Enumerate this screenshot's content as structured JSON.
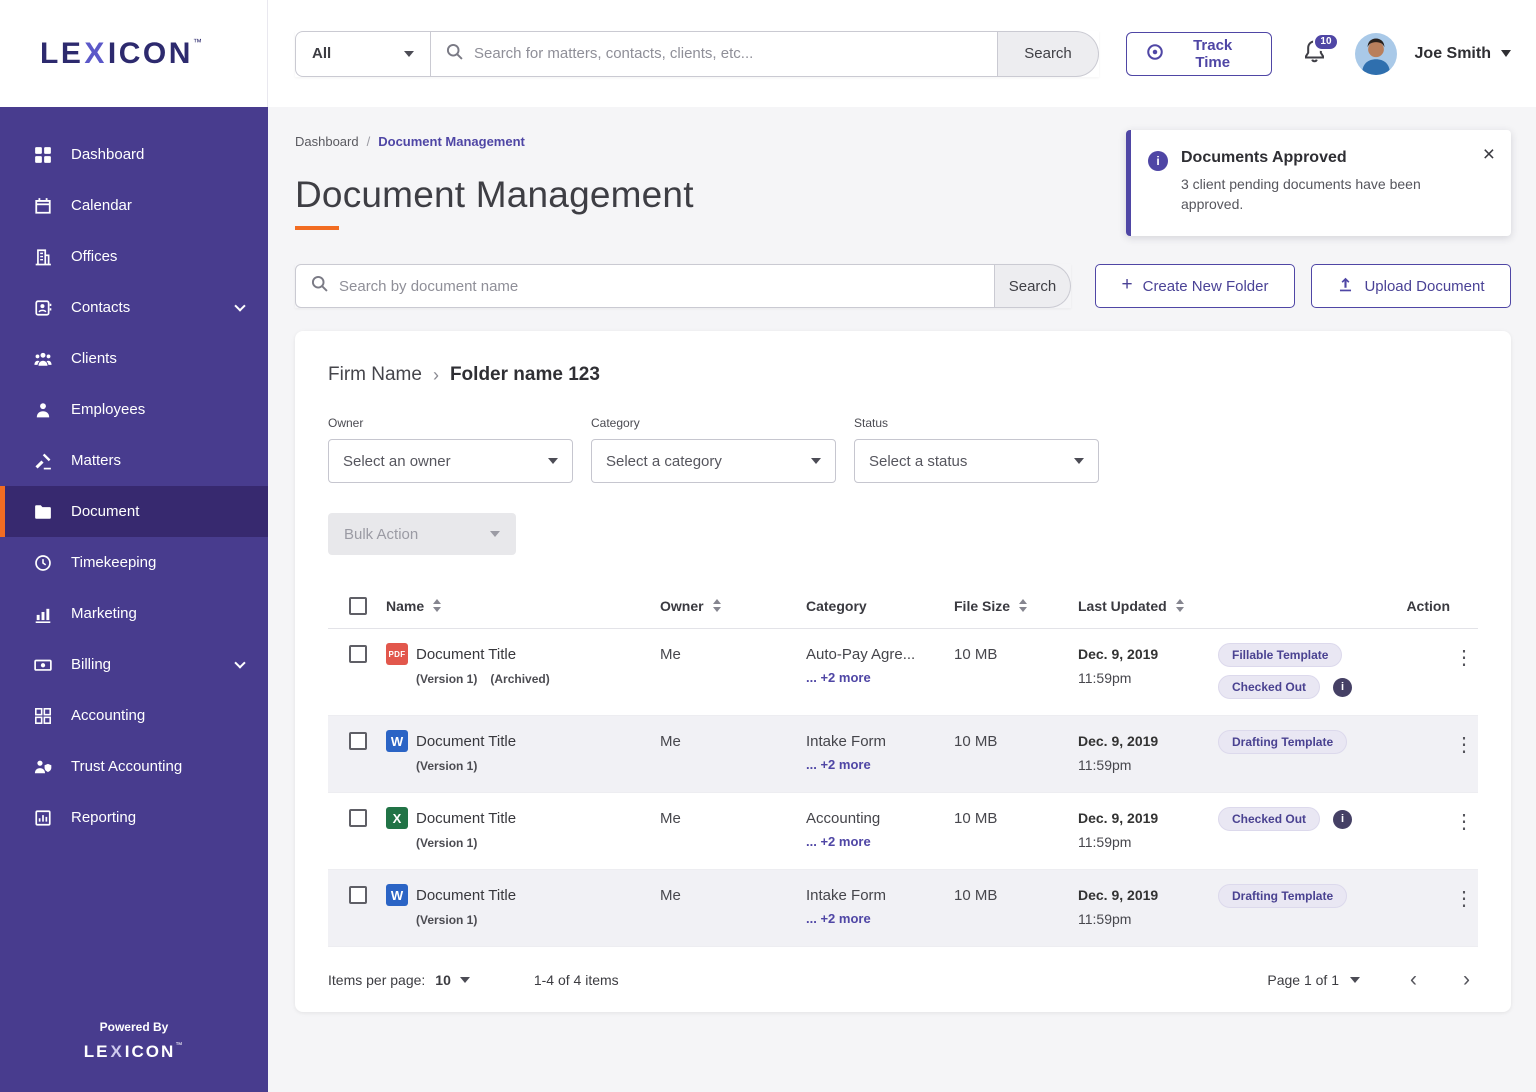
{
  "colors": {
    "accent_purple": "#4F46A5",
    "sidebar_purple": "#483C8E",
    "active_orange": "#F26C22"
  },
  "brand": {
    "logo_pre": "LE",
    "logo_x": "X",
    "logo_post": "ICON",
    "trademark": "™",
    "powered_by": "Powered By"
  },
  "topbar": {
    "scope_value": "All",
    "search_placeholder": "Search for matters, contacts, clients, etc...",
    "search_button": "Search",
    "track_time_button": "Track Time",
    "notification_count": "10",
    "user_name": "Joe Smith"
  },
  "sidebar": {
    "items": [
      {
        "label": "Dashboard"
      },
      {
        "label": "Calendar"
      },
      {
        "label": "Offices"
      },
      {
        "label": "Contacts"
      },
      {
        "label": "Clients"
      },
      {
        "label": "Employees"
      },
      {
        "label": "Matters"
      },
      {
        "label": "Document"
      },
      {
        "label": "Timekeeping"
      },
      {
        "label": "Marketing"
      },
      {
        "label": "Billing"
      },
      {
        "label": "Accounting"
      },
      {
        "label": "Trust Accounting"
      },
      {
        "label": "Reporting"
      }
    ]
  },
  "page": {
    "breadcrumb_home": "Dashboard",
    "breadcrumb_sep": "/",
    "breadcrumb_current": "Document Management",
    "title": "Document Management",
    "toast": {
      "title": "Documents Approved",
      "body": "3 client pending documents have been approved."
    },
    "doc_search_placeholder": "Search by document name",
    "doc_search_button": "Search",
    "create_folder_button": "Create New Folder",
    "upload_button": "Upload Document"
  },
  "folder": {
    "firm_name": "Firm Name",
    "separator": "›",
    "folder_name": "Folder name 123"
  },
  "filters": {
    "owner_label": "Owner",
    "owner_value": "Select an owner",
    "category_label": "Category",
    "category_value": "Select a category",
    "status_label": "Status",
    "status_value": "Select a status",
    "bulk_action_button": "Bulk Action"
  },
  "table": {
    "headers": {
      "name": "Name",
      "owner": "Owner",
      "category": "Category",
      "file_size": "File Size",
      "last_updated": "Last Updated",
      "action": "Action"
    },
    "rows": [
      {
        "file_type": "pdf",
        "file_label": "PDF",
        "name": "Document Title",
        "version": "(Version 1)",
        "archived": "(Archived)",
        "owner": "Me",
        "category": "Auto-Pay Agre...",
        "category_more": "... +2 more",
        "file_size": "10 MB",
        "date": "Dec. 9, 2019",
        "time": "11:59pm",
        "badges": [
          "Fillable Template",
          "Checked Out"
        ]
      },
      {
        "file_type": "word",
        "file_label": "W",
        "name": "Document Title",
        "version": "(Version 1)",
        "owner": "Me",
        "category": "Intake Form",
        "category_more": "... +2 more",
        "file_size": "10 MB",
        "date": "Dec. 9, 2019",
        "time": "11:59pm",
        "badges": [
          "Drafting Template"
        ]
      },
      {
        "file_type": "excel",
        "file_label": "X",
        "name": "Document Title",
        "version": "(Version 1)",
        "owner": "Me",
        "category": "Accounting",
        "category_more": "... +2 more",
        "file_size": "10 MB",
        "date": "Dec. 9, 2019",
        "time": "11:59pm",
        "badges": [
          "Checked Out"
        ]
      },
      {
        "file_type": "word",
        "file_label": "W",
        "name": "Document Title",
        "version": "(Version 1)",
        "owner": "Me",
        "category": "Intake Form",
        "category_more": "... +2 more",
        "file_size": "10 MB",
        "date": "Dec. 9, 2019",
        "time": "11:59pm",
        "badges": [
          "Drafting Template"
        ]
      }
    ]
  },
  "pagination": {
    "items_per_page_label": "Items per page:",
    "items_per_page_value": "10",
    "range_text": "1-4 of 4 items",
    "page_text": "Page 1 of 1"
  }
}
